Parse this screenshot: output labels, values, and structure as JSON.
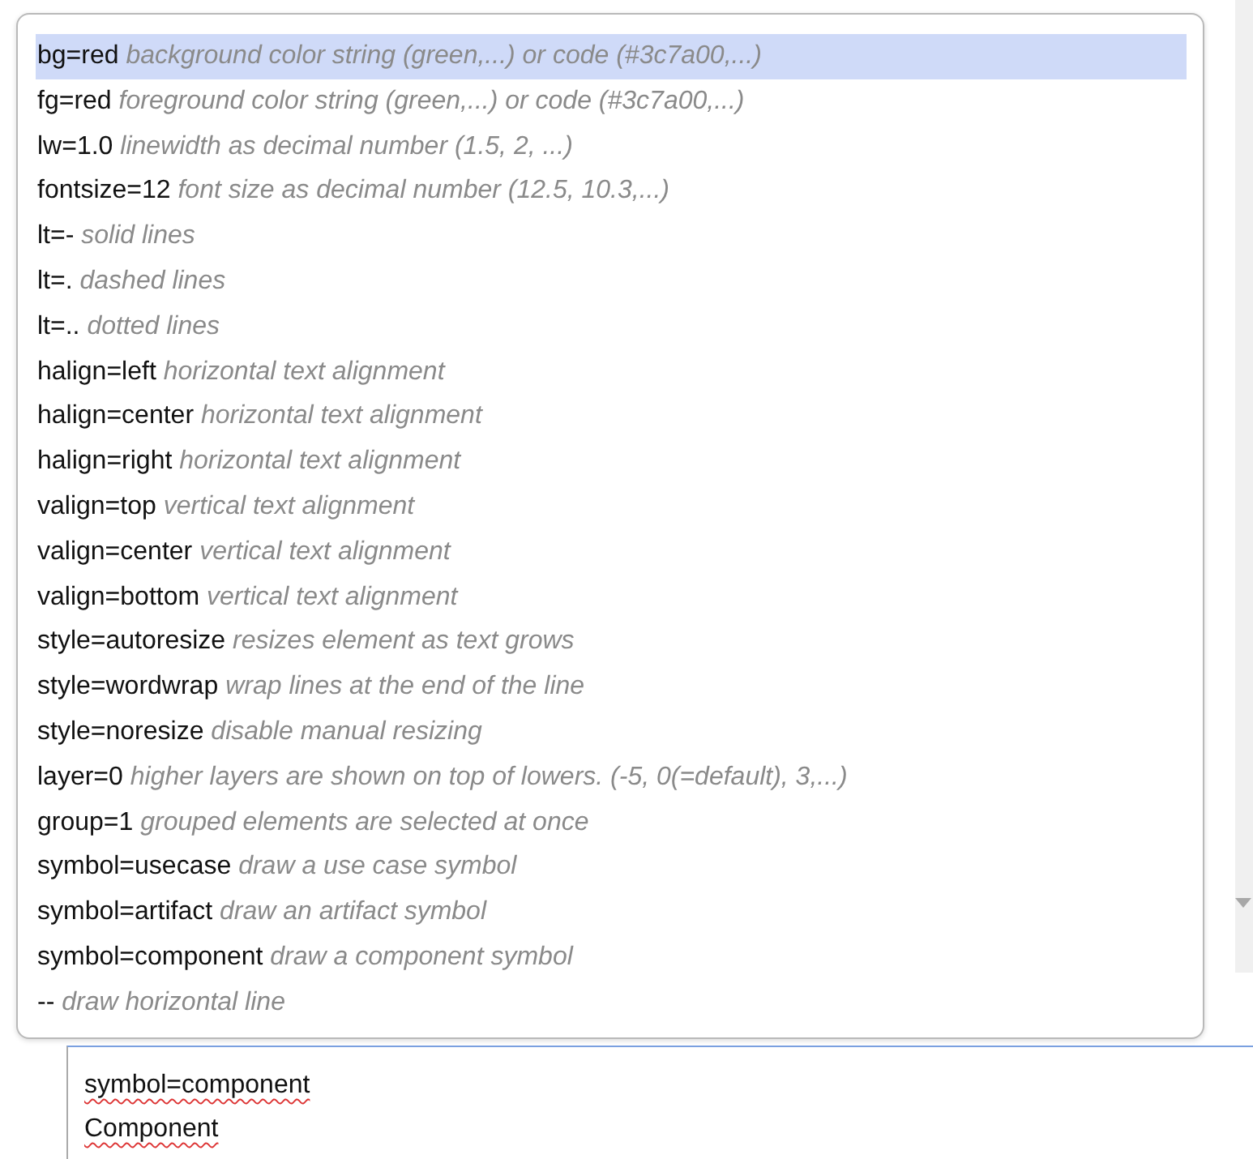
{
  "suggestions": [
    {
      "key": "bg=red",
      "hint": "background color string (green,...) or code (#3c7a00,...)",
      "selected": true
    },
    {
      "key": "fg=red",
      "hint": "foreground color string (green,...) or code (#3c7a00,...)",
      "selected": false
    },
    {
      "key": "lw=1.0",
      "hint": "linewidth as decimal number (1.5, 2, ...)",
      "selected": false
    },
    {
      "key": "fontsize=12",
      "hint": "font size as decimal number (12.5, 10.3,...)",
      "selected": false
    },
    {
      "key": "lt=-",
      "hint": "solid lines",
      "selected": false
    },
    {
      "key": "lt=.",
      "hint": "dashed lines",
      "selected": false
    },
    {
      "key": "lt=..",
      "hint": "dotted lines",
      "selected": false
    },
    {
      "key": "halign=left",
      "hint": "horizontal text alignment",
      "selected": false
    },
    {
      "key": "halign=center",
      "hint": "horizontal text alignment",
      "selected": false
    },
    {
      "key": "halign=right",
      "hint": "horizontal text alignment",
      "selected": false
    },
    {
      "key": "valign=top",
      "hint": "vertical text alignment",
      "selected": false
    },
    {
      "key": "valign=center",
      "hint": "vertical text alignment",
      "selected": false
    },
    {
      "key": "valign=bottom",
      "hint": "vertical text alignment",
      "selected": false
    },
    {
      "key": "style=autoresize",
      "hint": "resizes element as text grows",
      "selected": false
    },
    {
      "key": "style=wordwrap",
      "hint": "wrap lines at the end of the line",
      "selected": false
    },
    {
      "key": "style=noresize",
      "hint": "disable manual resizing",
      "selected": false
    },
    {
      "key": "layer=0",
      "hint": "higher layers are shown on top of lowers. (-5, 0(=default), 3,...)",
      "selected": false
    },
    {
      "key": "group=1",
      "hint": "grouped elements are selected at once",
      "selected": false
    },
    {
      "key": "symbol=usecase",
      "hint": "draw a use case symbol",
      "selected": false
    },
    {
      "key": "symbol=artifact",
      "hint": "draw an artifact symbol",
      "selected": false
    },
    {
      "key": "symbol=component",
      "hint": "draw a component symbol",
      "selected": false
    },
    {
      "key": "--",
      "hint": "draw horizontal line",
      "selected": false
    }
  ],
  "editor": {
    "lines": [
      "symbol=component",
      "Component"
    ]
  }
}
